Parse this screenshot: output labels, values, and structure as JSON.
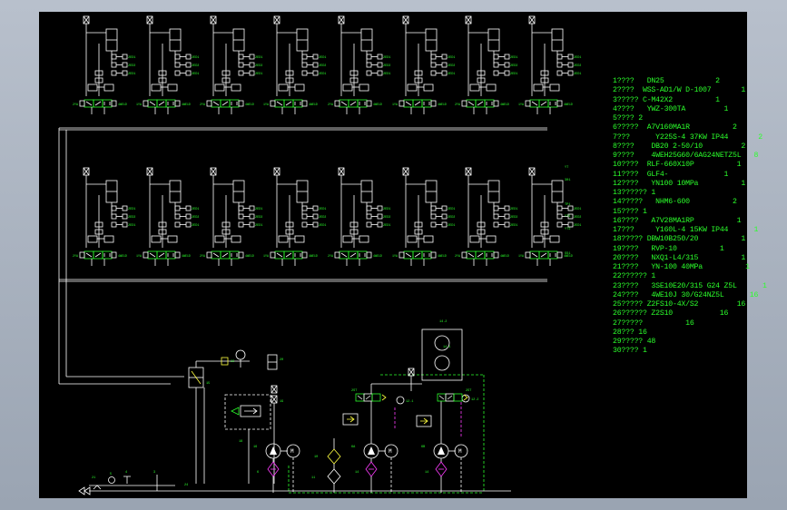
{
  "colors": {
    "background": "#000000",
    "line": "#ffffff",
    "green": "#2bff2b",
    "magenta": "#ff3cff",
    "yellow": "#ffff40",
    "red": "#ff4040",
    "desktop": "#a6aebb"
  },
  "bom": [
    {
      "no": "1????",
      "text": "   DN25            2"
    },
    {
      "no": "2????",
      "text": "  WSS-AD1/W D-1007       1"
    },
    {
      "no": "3?????",
      "text": " C-M42X2          1"
    },
    {
      "no": "4????",
      "text": "   YWZ-300TA         1"
    },
    {
      "no": "5????",
      "text": " 2"
    },
    {
      "no": "6?????",
      "text": "  A7V160MA1R          2"
    },
    {
      "no": "7???",
      "text": "      Y225S-4 37KW IP44       2"
    },
    {
      "no": "8????",
      "text": "    DB20 2-50/10         2"
    },
    {
      "no": "9????",
      "text": "    4WEH25G60/6AG24NETZ5L   8"
    },
    {
      "no": "10????",
      "text": "  RLF-660X10P          1"
    },
    {
      "no": "11????",
      "text": "  GLF4-             1"
    },
    {
      "no": "12????",
      "text": "   YN100 10MPa          1"
    },
    {
      "no": "13??????",
      "text": " 1"
    },
    {
      "no": "14?????",
      "text": "   NHM6-600          2"
    },
    {
      "no": "15????",
      "text": " 1"
    },
    {
      "no": "16????",
      "text": "   A7V28MA1RP          1"
    },
    {
      "no": "17???",
      "text": "     Y160L-4 15KW IP44      1"
    },
    {
      "no": "18?????",
      "text": " DBW10B250/20          1"
    },
    {
      "no": "19????",
      "text": "   RVP-10          1"
    },
    {
      "no": "20????",
      "text": "   NXQ1-L4/315          1"
    },
    {
      "no": "21????",
      "text": "   YN-100 40MPa          1"
    },
    {
      "no": "22??????",
      "text": " 1"
    },
    {
      "no": "23????",
      "text": "   3SE10E20/315 G24 Z5L      1"
    },
    {
      "no": "24????",
      "text": "   4WE10J 30/G24NZ5L      16"
    },
    {
      "no": "25?????",
      "text": " Z2FS10-4X/S2         16"
    },
    {
      "no": "26??????",
      "text": " Z2S10           16"
    },
    {
      "no": "27?????",
      "text": "          16"
    },
    {
      "no": "28???",
      "text": " 16"
    },
    {
      "no": "29?????",
      "text": " 48"
    },
    {
      "no": "30????",
      "text": " 1"
    }
  ],
  "diagram": {
    "top_row": {
      "valve_tag": "4WE1D",
      "port_labels": [
        "2ED1",
        "2ED2"
      ],
      "port_tag": "Z2FS"
    },
    "second_row": {
      "valve_tag": "4WE1D",
      "port_labels": [
        "2ED1",
        "2ED2"
      ],
      "right_tags": [
        "YT",
        "301",
        "TP1",
        "YT1",
        "YT2",
        "SS1"
      ]
    },
    "unit_tags": [
      "1B",
      "1D",
      "20",
      "22",
      "2",
      "15",
      "19",
      "8",
      "1",
      "16",
      "7",
      "6",
      "14",
      "12",
      "14A",
      "14B",
      "6A",
      "6B",
      "4",
      "5",
      "24"
    ],
    "unit_count_per_row": 8
  }
}
